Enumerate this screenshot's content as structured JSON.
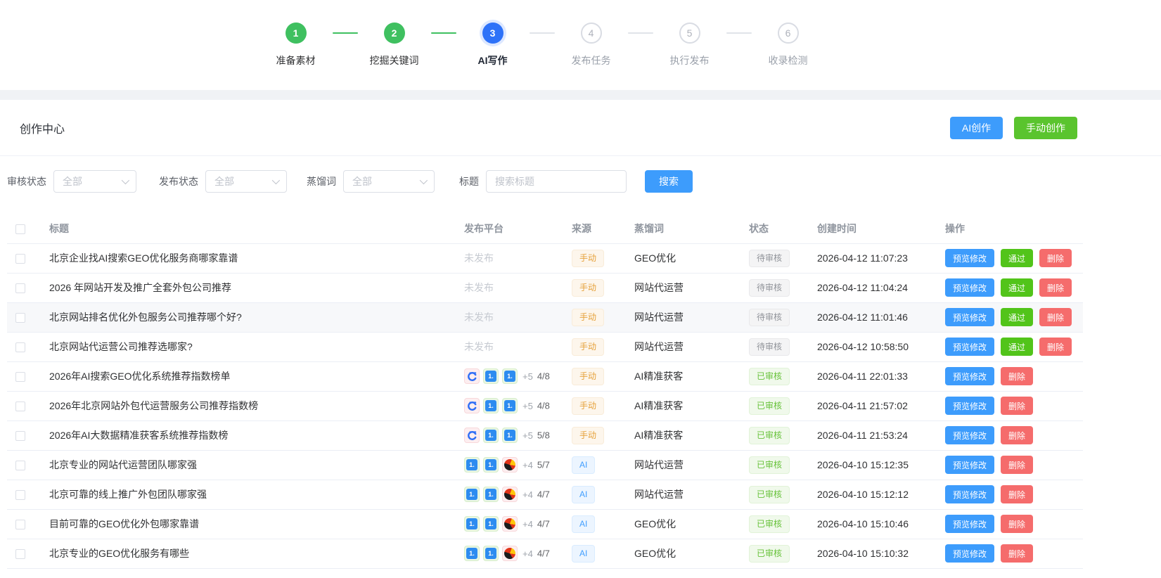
{
  "stepper": {
    "steps": [
      {
        "num": "1",
        "label": "准备素材",
        "state": "done"
      },
      {
        "num": "2",
        "label": "挖掘关键词",
        "state": "done"
      },
      {
        "num": "3",
        "label": "AI写作",
        "state": "active"
      },
      {
        "num": "4",
        "label": "发布任务",
        "state": "pending"
      },
      {
        "num": "5",
        "label": "执行发布",
        "state": "pending"
      },
      {
        "num": "6",
        "label": "收录检测",
        "state": "pending"
      }
    ]
  },
  "header": {
    "title": "创作中心",
    "ai_create_label": "AI创作",
    "manual_create_label": "手动创作"
  },
  "filters": {
    "audit_label": "审核状态",
    "audit_value": "全部",
    "publish_label": "发布状态",
    "publish_value": "全部",
    "word_label": "蒸馏词",
    "word_value": "全部",
    "title_label": "标题",
    "title_placeholder": "搜索标题",
    "search_button": "搜索"
  },
  "colors": {
    "accent_blue": "#3d9cfc",
    "success_green": "#52c41a",
    "danger_red": "#f56c6c",
    "step_green": "#3fc060",
    "step_active_blue": "#2e72f8"
  },
  "table": {
    "columns": [
      "标题",
      "发布平台",
      "来源",
      "蒸馏词",
      "状态",
      "创建时间",
      "操作"
    ],
    "unpublished_text": "未发布",
    "action_labels": {
      "preview": "预览修改",
      "pass": "通过",
      "delete": "删除"
    },
    "rows": [
      {
        "title": "北京企业找AI搜索GEO优化服务商哪家靠谱",
        "platform": {
          "published": false
        },
        "source": {
          "type": "manual",
          "label": "手动"
        },
        "word": "GEO优化",
        "status": {
          "type": "pending",
          "label": "待审核"
        },
        "time": "2026-04-12 11:07:23",
        "actions": [
          "preview",
          "pass",
          "delete"
        ],
        "highlight": false
      },
      {
        "title": "2026 年网站开发及推广全套外包公司推荐",
        "platform": {
          "published": false
        },
        "source": {
          "type": "manual",
          "label": "手动"
        },
        "word": "网站代运营",
        "status": {
          "type": "pending",
          "label": "待审核"
        },
        "time": "2026-04-12 11:04:24",
        "actions": [
          "preview",
          "pass",
          "delete"
        ],
        "highlight": false
      },
      {
        "title": "北京网站排名优化外包服务公司推荐哪个好?",
        "platform": {
          "published": false
        },
        "source": {
          "type": "manual",
          "label": "手动"
        },
        "word": "网站代运营",
        "status": {
          "type": "pending",
          "label": "待审核"
        },
        "time": "2026-04-12 11:01:46",
        "actions": [
          "preview",
          "pass",
          "delete"
        ],
        "highlight": true
      },
      {
        "title": "北京网站代运营公司推荐选哪家?",
        "platform": {
          "published": false
        },
        "source": {
          "type": "manual",
          "label": "手动"
        },
        "word": "网站代运营",
        "status": {
          "type": "pending",
          "label": "待审核"
        },
        "time": "2026-04-12 10:58:50",
        "actions": [
          "preview",
          "pass",
          "delete"
        ],
        "highlight": false
      },
      {
        "title": "2026年AI搜索GEO优化系统推荐指数榜单",
        "platform": {
          "published": true,
          "icons": [
            "c",
            "one",
            "one"
          ],
          "more": "+5",
          "count": "4/8"
        },
        "source": {
          "type": "manual",
          "label": "手动"
        },
        "word": "AI精准获客",
        "status": {
          "type": "approved",
          "label": "已审核"
        },
        "time": "2026-04-11 22:01:33",
        "actions": [
          "preview",
          "delete"
        ],
        "highlight": false
      },
      {
        "title": "2026年北京网站外包代运营服务公司推荐指数榜",
        "platform": {
          "published": true,
          "icons": [
            "c",
            "one",
            "one"
          ],
          "more": "+5",
          "count": "4/8"
        },
        "source": {
          "type": "manual",
          "label": "手动"
        },
        "word": "AI精准获客",
        "status": {
          "type": "approved",
          "label": "已审核"
        },
        "time": "2026-04-11 21:57:02",
        "actions": [
          "preview",
          "delete"
        ],
        "highlight": false
      },
      {
        "title": "2026年AI大数据精准获客系统推荐指数榜",
        "platform": {
          "published": true,
          "icons": [
            "c",
            "one",
            "one"
          ],
          "more": "+5",
          "count": "5/8"
        },
        "source": {
          "type": "manual",
          "label": "手动"
        },
        "word": "AI精准获客",
        "status": {
          "type": "approved",
          "label": "已审核"
        },
        "time": "2026-04-11 21:53:24",
        "actions": [
          "preview",
          "delete"
        ],
        "highlight": false
      },
      {
        "title": "北京专业的网站代运营团队哪家强",
        "platform": {
          "published": true,
          "icons": [
            "one",
            "one",
            "flame"
          ],
          "more": "+4",
          "count": "5/7"
        },
        "source": {
          "type": "ai",
          "label": "AI"
        },
        "word": "网站代运营",
        "status": {
          "type": "approved",
          "label": "已审核"
        },
        "time": "2026-04-10 15:12:35",
        "actions": [
          "preview",
          "delete"
        ],
        "highlight": false
      },
      {
        "title": "北京可靠的线上推广外包团队哪家强",
        "platform": {
          "published": true,
          "icons": [
            "one",
            "one",
            "flame"
          ],
          "more": "+4",
          "count": "4/7"
        },
        "source": {
          "type": "ai",
          "label": "AI"
        },
        "word": "网站代运营",
        "status": {
          "type": "approved",
          "label": "已审核"
        },
        "time": "2026-04-10 15:12:12",
        "actions": [
          "preview",
          "delete"
        ],
        "highlight": false
      },
      {
        "title": "目前可靠的GEO优化外包哪家靠谱",
        "platform": {
          "published": true,
          "icons": [
            "one",
            "one",
            "flame"
          ],
          "more": "+4",
          "count": "4/7"
        },
        "source": {
          "type": "ai",
          "label": "AI"
        },
        "word": "GEO优化",
        "status": {
          "type": "approved",
          "label": "已审核"
        },
        "time": "2026-04-10 15:10:46",
        "actions": [
          "preview",
          "delete"
        ],
        "highlight": false
      },
      {
        "title": "北京专业的GEO优化服务有哪些",
        "platform": {
          "published": true,
          "icons": [
            "one",
            "one",
            "flame"
          ],
          "more": "+4",
          "count": "4/7"
        },
        "source": {
          "type": "ai",
          "label": "AI"
        },
        "word": "GEO优化",
        "status": {
          "type": "approved",
          "label": "已审核"
        },
        "time": "2026-04-10 15:10:32",
        "actions": [
          "preview",
          "delete"
        ],
        "highlight": false
      }
    ]
  }
}
